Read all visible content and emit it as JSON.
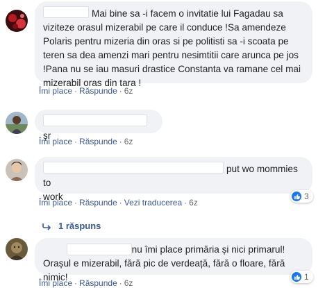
{
  "comments": [
    {
      "text_after_name": "Mai bine sa -i facem o invitatie lui Fagadau sa viziteze orasul mizerabil pe care il conduce !Sa amendeze Polaris pentru mizeria din oras si pe politisti sa -i scoata pe teren sa dea amenzi mari pentru nesimtitii care arunca pe jos !Pana nu se iau masuri drastice Constanta va ramane cel mai mizerabil oras din tara !",
      "like": "Îmi place",
      "reply": "Răspunde",
      "time": "6z"
    },
    {
      "text_after_name": "șr",
      "like": "Îmi place",
      "reply": "Răspunde",
      "time": "6z"
    },
    {
      "text_after_name": "put wo mommies to",
      "text_line2": "work",
      "like": "Îmi place",
      "reply": "Răspunde",
      "translate": "Vezi traducerea",
      "time": "6z",
      "reactions": "3",
      "replies_label": "1 răspuns"
    },
    {
      "text_after_name": "Mie nu îmi place primăria și nici primarul! Orașul e mizerabil, fără pic de verdeață, fără o floare, fără nimic!",
      "like": "Îmi place",
      "reply": "Răspunde",
      "time": "6z",
      "reactions": "1"
    }
  ],
  "separator": "·",
  "colors": {
    "bubble": "#f0f2f5",
    "link": "#385898",
    "like_blue": "#1877f2"
  },
  "icons": {
    "reaction": "thumbs-up-icon",
    "reply_arrow": "reply-arrow-icon"
  }
}
